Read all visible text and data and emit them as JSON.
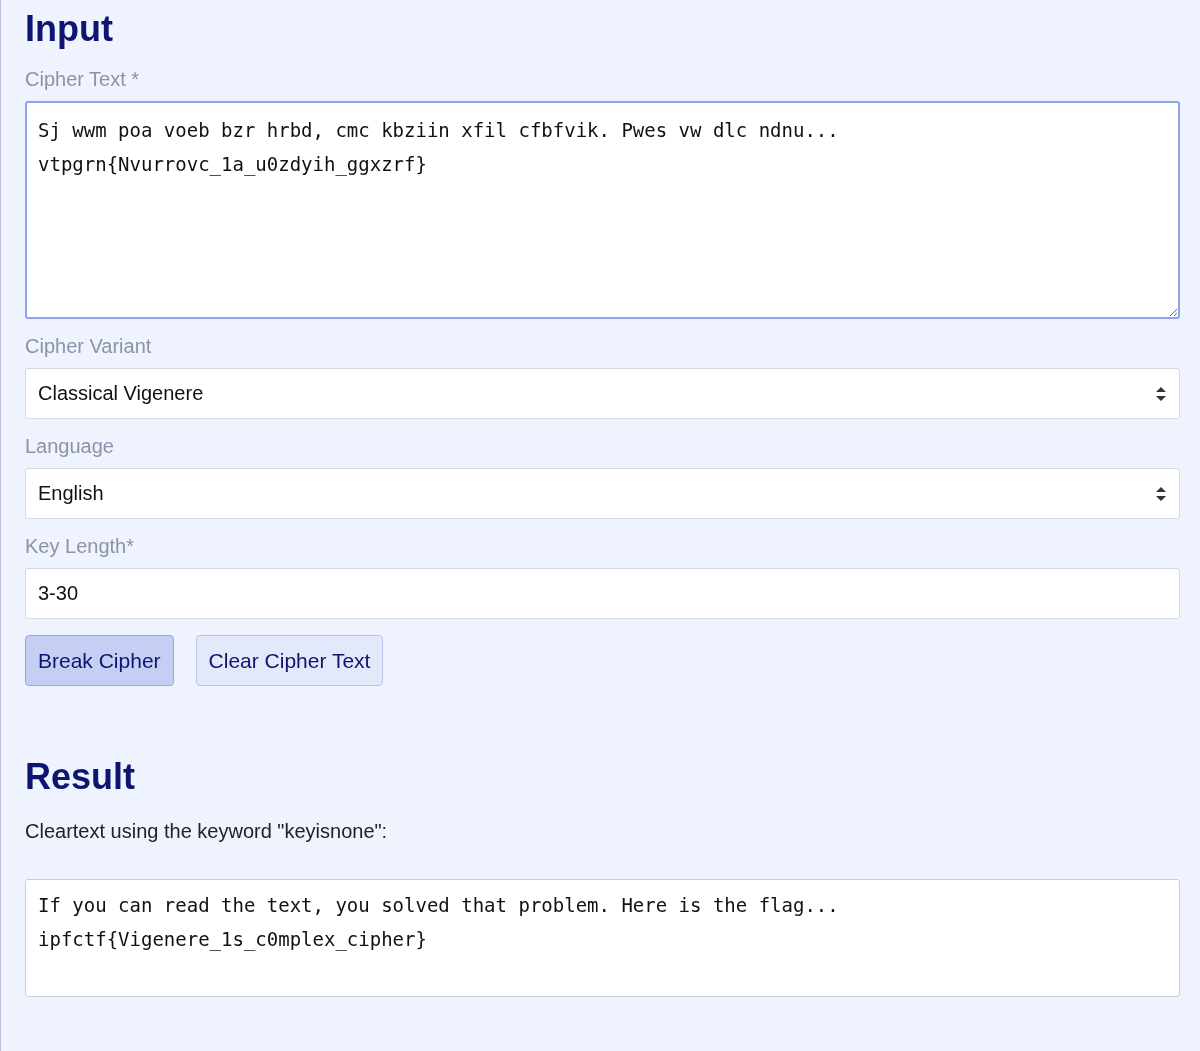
{
  "input": {
    "heading": "Input",
    "fields": [
      {
        "kind": "textarea",
        "label": "Cipher Text *",
        "value": "Sj wwm poa voeb bzr hrbd, cmc kbziin xfil cfbfvik. Pwes vw dlc ndnu...\nvtpgrn{Nvurrovc_1a_u0zdyih_ggxzrf}",
        "focused": true
      },
      {
        "kind": "select",
        "label": "Cipher Variant",
        "value": "Classical Vigenere"
      },
      {
        "kind": "select",
        "label": "Language",
        "value": "English"
      },
      {
        "kind": "text",
        "label": "Key Length*",
        "value": "3-30"
      }
    ],
    "buttons": [
      {
        "label": "Break Cipher",
        "primary": true
      },
      {
        "label": "Clear Cipher Text",
        "primary": false
      }
    ]
  },
  "result": {
    "heading": "Result",
    "caption": "Cleartext using the keyword \"keyisnone\":",
    "output": "If you can read the text, you solved that problem. Here is the flag...\nipfctf{Vigenere_1s_c0mplex_cipher}"
  }
}
